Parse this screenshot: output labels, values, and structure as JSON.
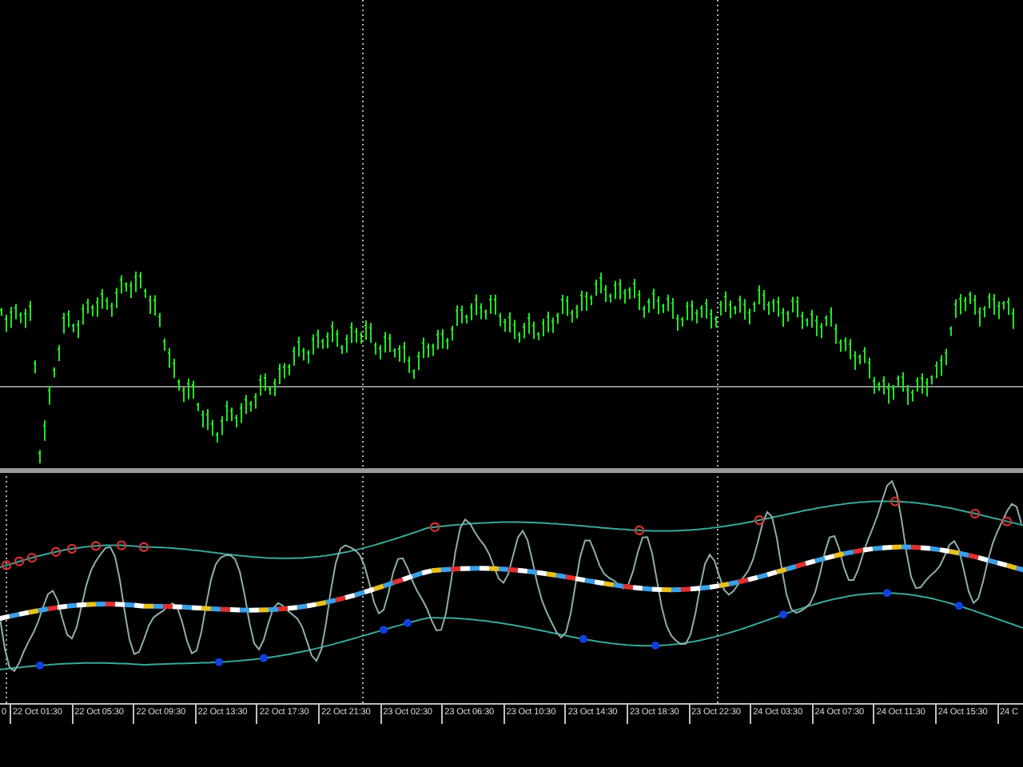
{
  "chart": {
    "time_axis": {
      "labels": [
        "0",
        "22 Oct 01:30",
        "22 Oct 05:30",
        "22 Oct 09:30",
        "22 Oct 13:30",
        "22 Oct 17:30",
        "22 Oct 21:30",
        "23 Oct 02:30",
        "23 Oct 06:30",
        "23 Oct 10:30",
        "23 Oct 14:30",
        "23 Oct 18:30",
        "23 Oct 22:30",
        "24 Oct 03:30",
        "24 Oct 07:30",
        "24 Oct 11:30",
        "24 Oct 15:30",
        "24 C"
      ]
    }
  }
}
